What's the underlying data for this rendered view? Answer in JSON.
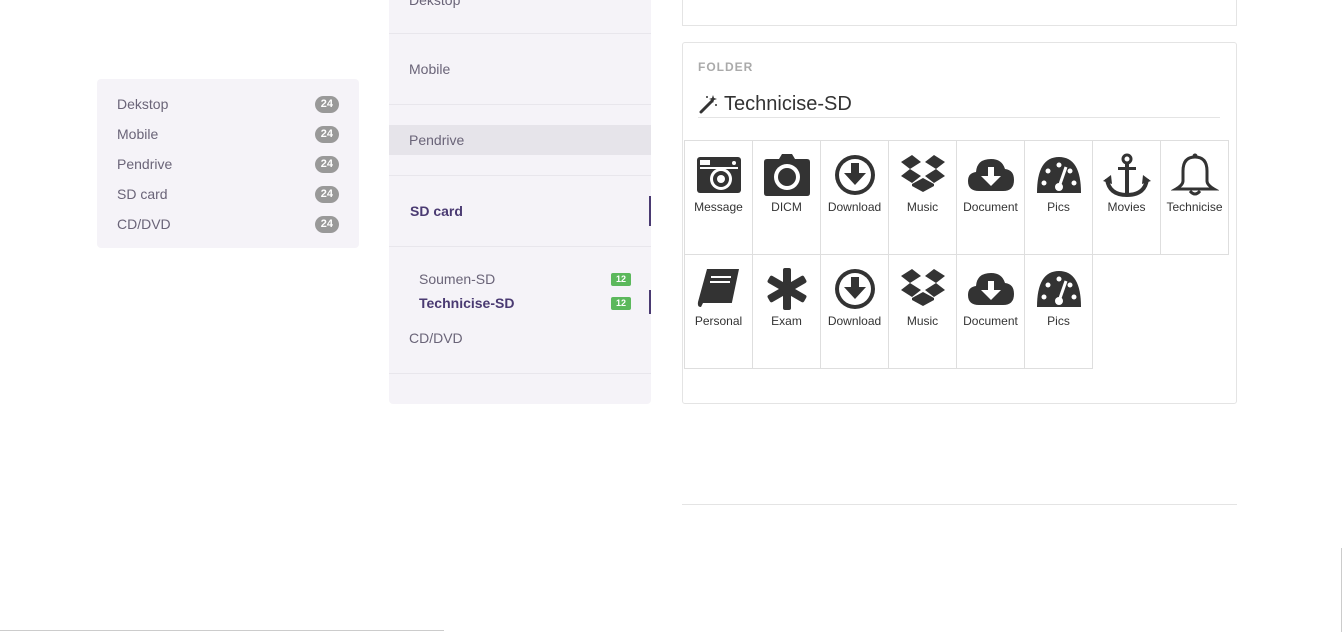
{
  "left_list": {
    "items": [
      {
        "label": "Dekstop",
        "count": "24"
      },
      {
        "label": "Mobile",
        "count": "24"
      },
      {
        "label": "Pendrive",
        "count": "24"
      },
      {
        "label": "SD card",
        "count": "24"
      },
      {
        "label": "CD/DVD",
        "count": "24"
      }
    ]
  },
  "tree": {
    "items": {
      "desktop": "Dekstop",
      "mobile": "Mobile",
      "pendrive": "Pendrive",
      "sdcard": "SD card",
      "cddvd": "CD/DVD"
    },
    "sub_items": [
      {
        "label": "Soumen-SD",
        "count": "12"
      },
      {
        "label": "Technicise-SD",
        "count": "12"
      }
    ]
  },
  "folder": {
    "label": "FOLDER",
    "title": "Technicise-SD",
    "title_icon": "magic-wand-icon",
    "tiles": [
      {
        "label": "Message",
        "icon": "camera-retro-icon"
      },
      {
        "label": "DICM",
        "icon": "camera-icon"
      },
      {
        "label": "Download",
        "icon": "download-circle-icon"
      },
      {
        "label": "Music",
        "icon": "dropbox-icon"
      },
      {
        "label": "Document",
        "icon": "cloud-download-icon"
      },
      {
        "label": "Pics",
        "icon": "dashboard-icon"
      },
      {
        "label": "Movies",
        "icon": "anchor-icon"
      },
      {
        "label": "Technicise",
        "icon": "bell-icon"
      },
      {
        "label": "Personal",
        "icon": "book-icon"
      },
      {
        "label": "Exam",
        "icon": "asterisk-icon"
      },
      {
        "label": "Download",
        "icon": "download-circle-icon"
      },
      {
        "label": "Music",
        "icon": "dropbox-icon"
      },
      {
        "label": "Document",
        "icon": "cloud-download-icon"
      },
      {
        "label": "Pics",
        "icon": "dashboard-icon"
      }
    ]
  },
  "colors": {
    "accent": "#4a3a72",
    "badge_grey": "#999999",
    "badge_green": "#5cb85c",
    "panel_bg": "#f5f3f8"
  }
}
